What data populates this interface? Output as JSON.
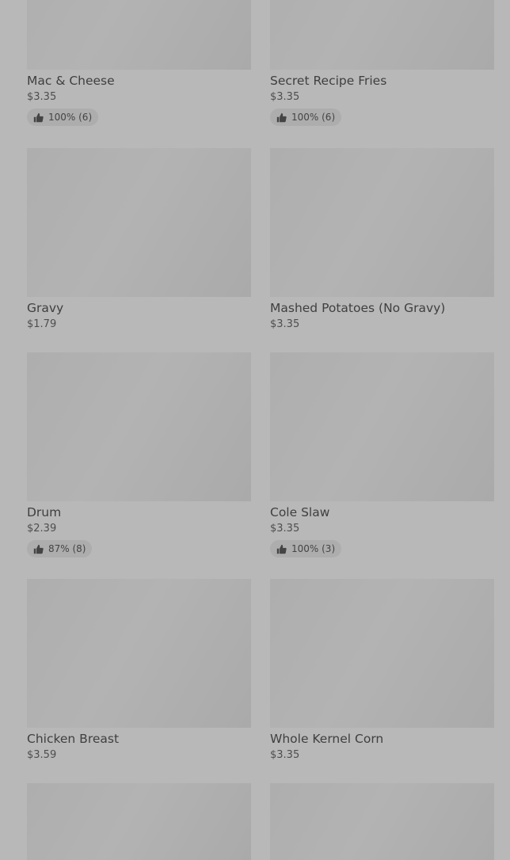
{
  "items": [
    {
      "name": "Mac & Cheese",
      "price": "$3.35",
      "rating": "100% (6)"
    },
    {
      "name": "Secret Recipe Fries",
      "price": "$3.35",
      "rating": "100% (6)"
    },
    {
      "name": "Gravy",
      "price": "$1.79",
      "rating": null
    },
    {
      "name": "Mashed Potatoes (No Gravy)",
      "price": "$3.35",
      "rating": null
    },
    {
      "name": "Drum",
      "price": "$2.39",
      "rating": "87% (8)"
    },
    {
      "name": "Cole Slaw",
      "price": "$3.35",
      "rating": "100% (3)"
    },
    {
      "name": "Chicken Breast",
      "price": "$3.59",
      "rating": null
    },
    {
      "name": "Whole Kernel Corn",
      "price": "$3.35",
      "rating": null
    },
    {
      "name": "",
      "price": "",
      "rating": null
    },
    {
      "name": "",
      "price": "",
      "rating": null
    }
  ],
  "icons": {
    "rating": "thumbs-up-icon"
  },
  "colors": {
    "overlay": "#b8b8b8",
    "image_placeholder": "#afafaf",
    "pill": "#adadad"
  }
}
